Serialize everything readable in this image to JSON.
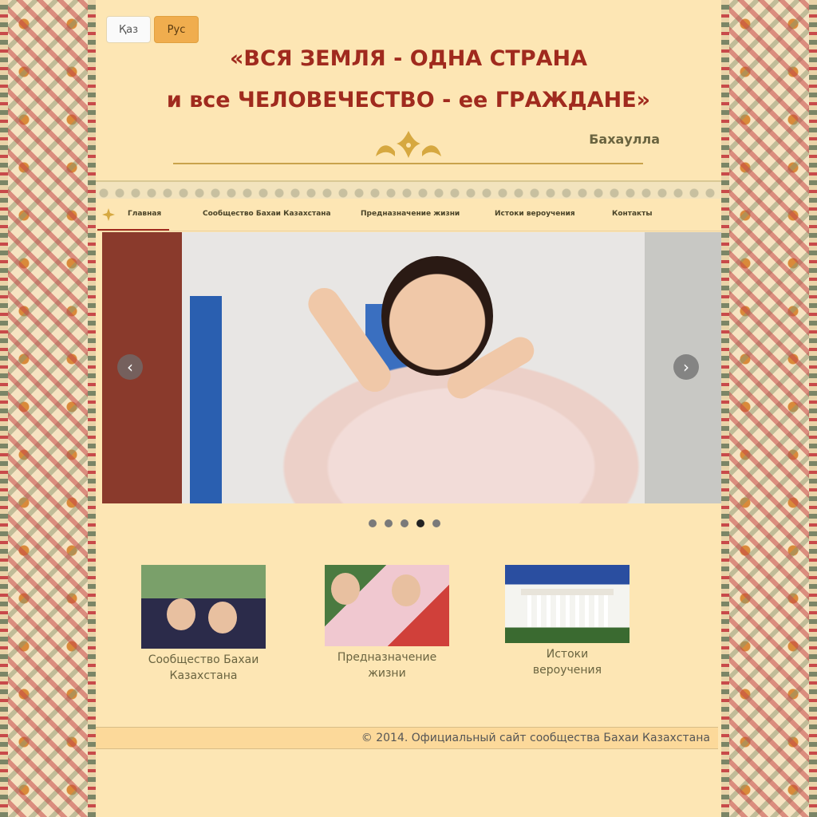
{
  "language": {
    "kaz_label": "Қаз",
    "rus_label": "Рус",
    "active": "Рус"
  },
  "header": {
    "quote_line1": "«ВСЯ ЗЕМЛЯ - ОДНА СТРАНА",
    "quote_line2": "и все ЧЕЛОВЕЧЕСТВО - ее ГРАЖДАНЕ»",
    "author": "Бахаулла"
  },
  "nav": {
    "items": [
      {
        "label": "Главная",
        "active": true
      },
      {
        "label": "Сообщество Бахаи Казахстана"
      },
      {
        "label": "Предназначение жизни"
      },
      {
        "label": "Истоки вероучения"
      },
      {
        "label": "Контакты"
      }
    ]
  },
  "slider": {
    "prev_icon": "chevron-left-icon",
    "next_icon": "chevron-right-icon",
    "slide_count": 5,
    "active_index": 3
  },
  "cards": [
    {
      "caption_line1": "Сообщество Бахаи",
      "caption_line2": "Казахстана"
    },
    {
      "caption_line1": "Предназначение",
      "caption_line2": "жизни"
    },
    {
      "caption_line1": "Истоки",
      "caption_line2": "вероучения"
    }
  ],
  "footer": {
    "text": "© 2014. Официальный сайт сообщества Бахаи Казахстана"
  },
  "colors": {
    "background": "#fde6b4",
    "title": "#a02a1e",
    "accent": "#f0ad4e"
  }
}
